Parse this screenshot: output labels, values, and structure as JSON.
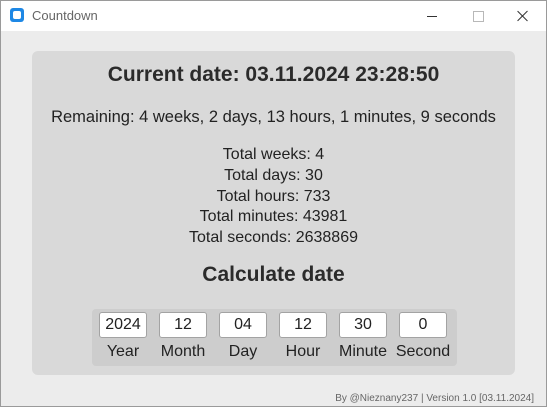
{
  "window": {
    "title": "Countdown",
    "icon": "app-icon"
  },
  "current_date": "Current date: 03.11.2024 23:28:50",
  "remaining": "Remaining: 4 weeks, 2 days, 13 hours, 1 minutes, 9 seconds",
  "totals": {
    "weeks": "Total weeks: 4",
    "days": "Total days: 30",
    "hours": "Total hours: 733",
    "minutes": "Total minutes: 43981",
    "seconds": "Total seconds: 2638869"
  },
  "calculate_title": "Calculate date",
  "inputs": [
    {
      "label": "Year",
      "value": "2024"
    },
    {
      "label": "Month",
      "value": "12"
    },
    {
      "label": "Day",
      "value": "04"
    },
    {
      "label": "Hour",
      "value": "12"
    },
    {
      "label": "Minute",
      "value": "30"
    },
    {
      "label": "Second",
      "value": "0"
    }
  ],
  "footer": "By @Nieznany237 | Version 1.0 [03.11.2024]"
}
